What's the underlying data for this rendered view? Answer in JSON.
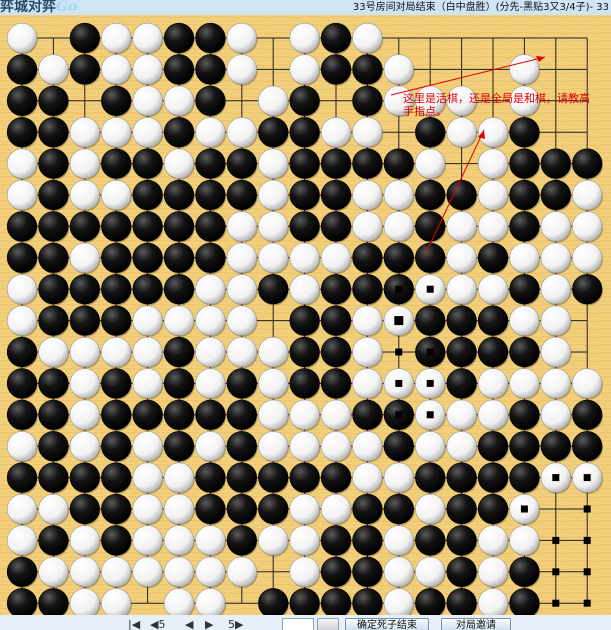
{
  "app": {
    "logo_text": "弈城对弈",
    "logo_tail": "Go"
  },
  "title": "33号房间对局结束（白中盘胜）(分先-黑贴3又3/4子)- 33",
  "annotation": {
    "line1": "这里是活棋，还是全局是和棋，请教高",
    "line2": "手指点。",
    "color": "#e00000"
  },
  "bottom_bar": {
    "nav_first": "|◀",
    "nav_back5": "◀5",
    "nav_prev": "◀",
    "nav_next": "▶",
    "nav_fwd5": "5▶",
    "confirm_button": "确定死子结束",
    "invite_button": "对局邀请"
  },
  "board": {
    "size": 19,
    "wood_color": "#f0cd78",
    "line_color": "#202020",
    "rows": [
      "W.XWWXXW.WXW.......",
      "XWXWWXXW.WXXW...W.",
      "XX.XWWX.WX.XWWW.W..",
      "XXWWWXWWXXWW.XWWX..",
      "WXWXXWXXWXXXXW.WXXX",
      "WXWWXXXXWXXWWXXWXXW",
      "XXXXXXXWWXXWWXWWXWW",
      "XXWXXXXWWWWXXXWXWWW",
      "WXXXXXWWXWXXXWWWXWX",
      "WXXXWWWW.XXWWXXXWW.",
      "XWWWWXWWWXXW.XXXXW.",
      "XXWXWXWXWXXWWWXWWWW",
      "XXWXXXXXWWWXXWWWXWX",
      "WXWXWXWXWWWWXWWXXXX",
      "XXXXWWXXXXXWWXXXXWW",
      "WWXXWWXXXWWXXWXXW..",
      "WXWXWWWXWWXXWXXWW..",
      "XWWWWWWW.WXXWWXWX..",
      "XXWW.WW.XXXXWXXWX.."
    ],
    "territory": [
      "r11c11",
      "r11c13",
      "r12c12",
      "r11c12"
    ]
  }
}
